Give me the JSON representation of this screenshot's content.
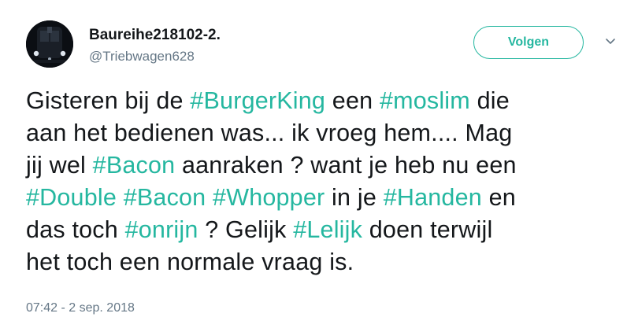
{
  "user": {
    "display_name": "Baureihe218102-2.",
    "handle": "@Triebwagen628",
    "avatar_icon": "train-front-avatar"
  },
  "follow_button": {
    "label": "Volgen"
  },
  "more_icon": "chevron-down-icon",
  "accent_color": "#25b7a0",
  "tweet": {
    "lines": [
      [
        {
          "t": "Gisteren bij de "
        },
        {
          "t": "#BurgerKing",
          "tag": true
        },
        {
          "t": " een "
        },
        {
          "t": "#moslim",
          "tag": true
        },
        {
          "t": " die"
        }
      ],
      [
        {
          "t": "aan het bedienen was... ik vroeg hem.... Mag"
        }
      ],
      [
        {
          "t": "jij wel "
        },
        {
          "t": "#Bacon",
          "tag": true
        },
        {
          "t": " aanraken ? want je heb nu een"
        }
      ],
      [
        {
          "t": "#Double",
          "tag": true
        },
        {
          "t": " "
        },
        {
          "t": "#Bacon",
          "tag": true
        },
        {
          "t": " "
        },
        {
          "t": "#Whopper",
          "tag": true
        },
        {
          "t": " in je "
        },
        {
          "t": "#Handen",
          "tag": true
        },
        {
          "t": " en"
        }
      ],
      [
        {
          "t": "das toch "
        },
        {
          "t": "#onrijn",
          "tag": true
        },
        {
          "t": " ? Gelijk "
        },
        {
          "t": "#Lelijk",
          "tag": true
        },
        {
          "t": " doen terwijl"
        }
      ],
      [
        {
          "t": "het toch een normale vraag is."
        }
      ]
    ]
  },
  "timestamp": "07:42 - 2 sep. 2018"
}
